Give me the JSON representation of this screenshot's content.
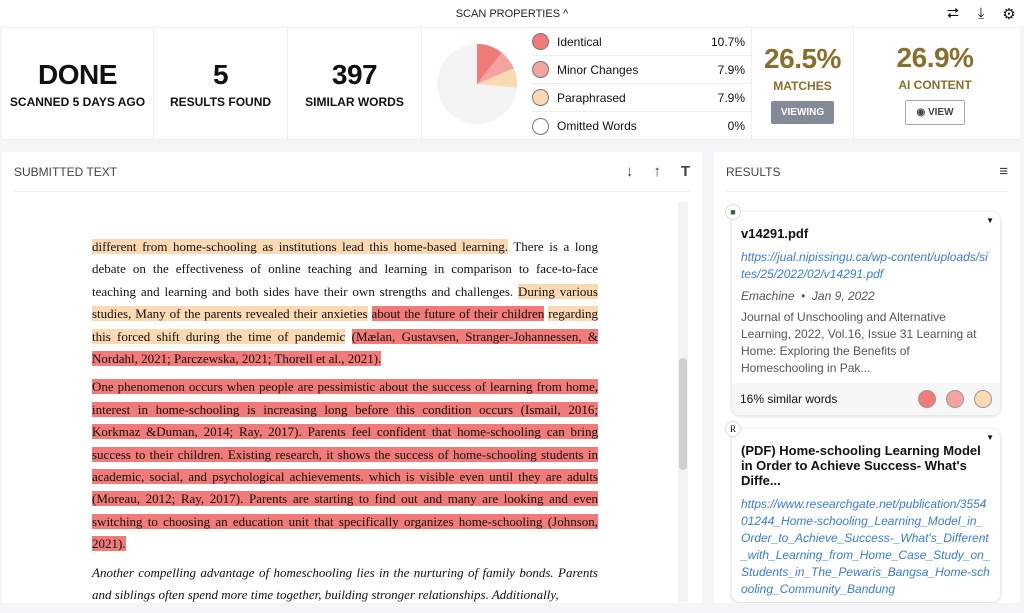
{
  "colors": {
    "identical": "#f07b78",
    "minor": "#f3a3a0",
    "paraphrased": "#fbd9b3",
    "omitted": "#ffffff",
    "gold": "#8a6f2c"
  },
  "topbar": {
    "title": "SCAN PROPERTIES",
    "chevron": "^",
    "icons": [
      "share-icon",
      "download-icon",
      "gear-icon"
    ]
  },
  "stats": [
    {
      "value": "DONE",
      "label": "SCANNED 5 DAYS AGO"
    },
    {
      "value": "5",
      "label": "RESULTS FOUND"
    },
    {
      "value": "397",
      "label": "SIMILAR WORDS"
    }
  ],
  "breakdown": [
    {
      "label": "Identical",
      "pct": "10.7%",
      "value": 10.7
    },
    {
      "label": "Minor Changes",
      "pct": "7.9%",
      "value": 7.9
    },
    {
      "label": "Paraphrased",
      "pct": "7.9%",
      "value": 7.9
    },
    {
      "label": "Omitted Words",
      "pct": "0%",
      "value": 0
    }
  ],
  "matches": {
    "value": "26.5%",
    "label": "MATCHES",
    "button": "VIEWING"
  },
  "ai": {
    "value": "26.9%",
    "label": "AI CONTENT",
    "button": "VIEW"
  },
  "doc": {
    "title": "SUBMITTED TEXT",
    "paragraphs": [
      [
        {
          "t": "para",
          "s": "different from home-schooling as institutions lead this home-based learning."
        },
        {
          "t": "plain",
          "s": "There is a long debate on the effectiveness of online teaching and learning in comparison to face-to-face teaching and learning and both sides have their own strengths and challenges."
        },
        {
          "t": "para",
          "s": "During various studies, Many of the parents revealed their anxieties"
        },
        {
          "t": "ident",
          "s": "about the future of their children"
        },
        {
          "t": "para",
          "s": "regarding this forced shift during the time of pandemic"
        },
        {
          "t": "ident",
          "s": "(Mælan, Gustavsen, Stranger-Johannessen, & Nordahl, 2021; Parczewska, 2021; Thorell et al., 2021)."
        }
      ],
      [
        {
          "t": "ident",
          "s": "One phenomenon occurs when people are pessimistic about the success of learning from home, interest in home-schooling is increasing long before this condition occurs (Ismail, 2016; Korkmaz &Duman, 2014; Ray, 2017). Parents feel confident that home-schooling can bring success to their children. Existing research, it shows the success of home-schooling students in academic, social, and psychological achievements. which is visible even until they are adults (Moreau, 2012; Ray, 2017). Parents are starting to find out and many are looking and even switching to choosing an education unit that specifically organizes home-schooling (Johnson, 2021)."
        }
      ],
      [
        {
          "t": "italic",
          "s": "Another compelling advantage of homeschooling lies in the nurturing of family bonds. Parents and siblings often spend more time together, building stronger relationships. Additionally,"
        }
      ]
    ]
  },
  "results": {
    "title": "RESULTS",
    "items": [
      {
        "title": "v14291.pdf",
        "url": "https://jual.nipissingu.ca/wp-content/uploads/sites/25/2022/02/v14291.pdf",
        "author": "Emachine",
        "date": "Jan 9, 2022",
        "desc": "Journal of Unschooling and Alternative Learning, 2022, Vol.16, Issue 31 Learning at Home: Exploring the Benefits of Homeschooling in Pak...",
        "similar": "16% similar words"
      },
      {
        "title": "(PDF) Home-schooling Learning Model in Order to Achieve Success- What's Diffe...",
        "url": "https://www.researchgate.net/publication/355401244_Home-schooling_Learning_Model_in_Order_to_Achieve_Success-_What's_Different_with_Learning_from_Home_Case_Study_on_Students_in_The_Pewaris_Bangsa_Home-schooling_Community_Bandung",
        "source_icon": "R"
      }
    ]
  }
}
